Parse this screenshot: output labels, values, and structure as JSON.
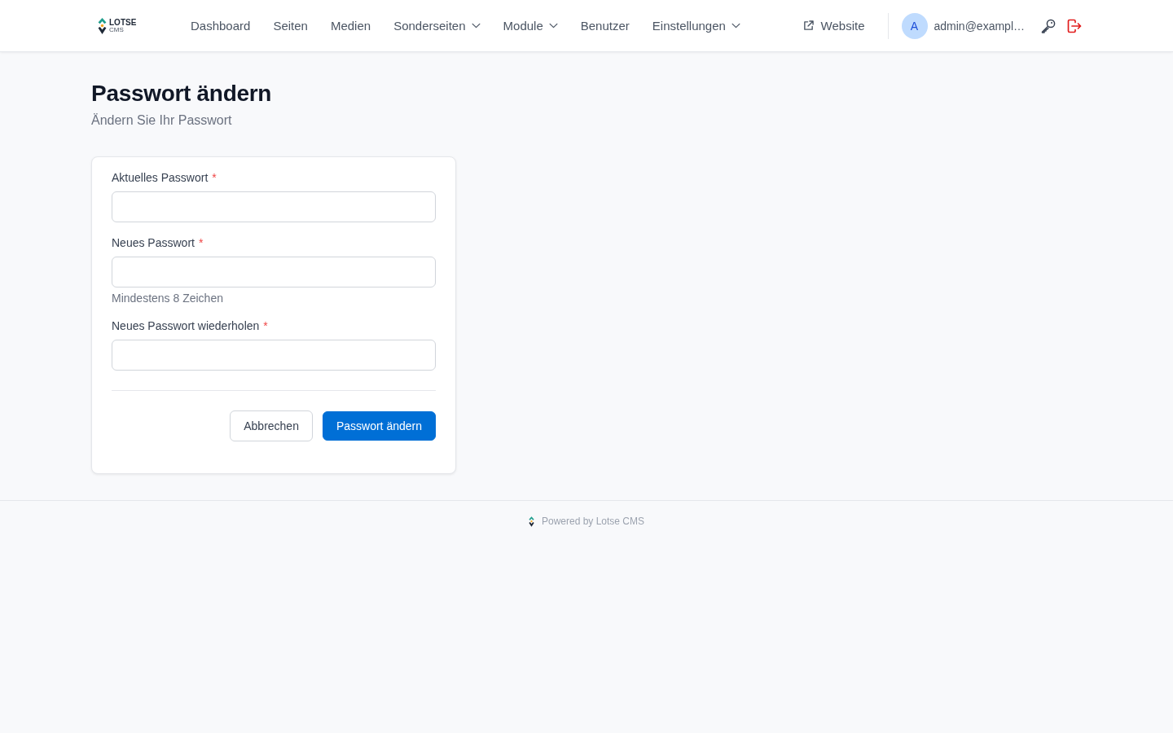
{
  "header": {
    "logo": {
      "name": "LOTSE",
      "sub": "CMS"
    },
    "nav": [
      {
        "label": "Dashboard",
        "has_menu": false
      },
      {
        "label": "Seiten",
        "has_menu": false
      },
      {
        "label": "Medien",
        "has_menu": false
      },
      {
        "label": "Sonderseiten",
        "has_menu": true
      },
      {
        "label": "Module",
        "has_menu": true
      },
      {
        "label": "Benutzer",
        "has_menu": false
      },
      {
        "label": "Einstellungen",
        "has_menu": true
      }
    ],
    "website_link": {
      "label": "Website"
    },
    "user": {
      "initial": "A",
      "email": "admin@exampl…"
    }
  },
  "page": {
    "title": "Passwort ändern",
    "subtitle": "Ändern Sie Ihr Passwort"
  },
  "form": {
    "fields": [
      {
        "label": "Aktuelles Passwort",
        "required_mark": "*"
      },
      {
        "label": "Neues Passwort",
        "required_mark": "*",
        "hint": "Mindestens 8 Zeichen"
      },
      {
        "label": "Neues Passwort wiederholen",
        "required_mark": "*"
      }
    ],
    "buttons": [
      {
        "label": "Abbrechen",
        "kind": "secondary"
      },
      {
        "label": "Passwort ändern",
        "kind": "primary"
      }
    ]
  },
  "footer": {
    "text": "Powered by Lotse CMS"
  }
}
